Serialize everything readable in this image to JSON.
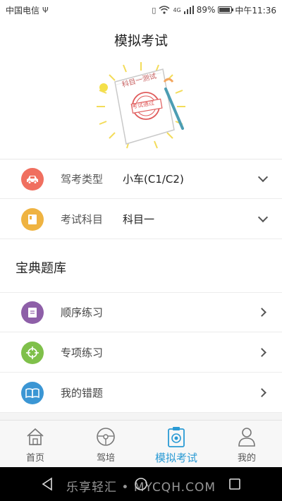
{
  "status_bar": {
    "carrier": "中国电信",
    "network_type": "4G",
    "battery": "89%",
    "battery_level": 0.89,
    "time": "中午11:36"
  },
  "header": {
    "title": "模拟考试"
  },
  "illustration": {
    "paper_title": "科目一测试",
    "stamp_text": "考试通过"
  },
  "settings": [
    {
      "label": "驾考类型",
      "value": "小车(C1/C2)",
      "icon": "car-icon",
      "color": "#f06f5f"
    },
    {
      "label": "考试科目",
      "value": "科目一",
      "icon": "book-icon",
      "color": "#efb341"
    }
  ],
  "library": {
    "title": "宝典题库",
    "items": [
      {
        "label": "顺序练习",
        "icon": "document-icon",
        "color": "#8e5fa8"
      },
      {
        "label": "专项练习",
        "icon": "crosshair-icon",
        "color": "#7fc04a"
      },
      {
        "label": "我的错题",
        "icon": "open-book-icon",
        "color": "#3b96d4"
      }
    ]
  },
  "tabs": [
    {
      "label": "首页",
      "icon": "home-icon"
    },
    {
      "label": "驾培",
      "icon": "steering-wheel-icon"
    },
    {
      "label": "模拟考试",
      "icon": "exam-badge-icon",
      "active": true
    },
    {
      "label": "我的",
      "icon": "person-icon"
    }
  ],
  "colors": {
    "accent": "#2a9ad4",
    "tab_inactive": "#555555"
  },
  "watermark": "乐享轻汇 • MYCQH.COM"
}
